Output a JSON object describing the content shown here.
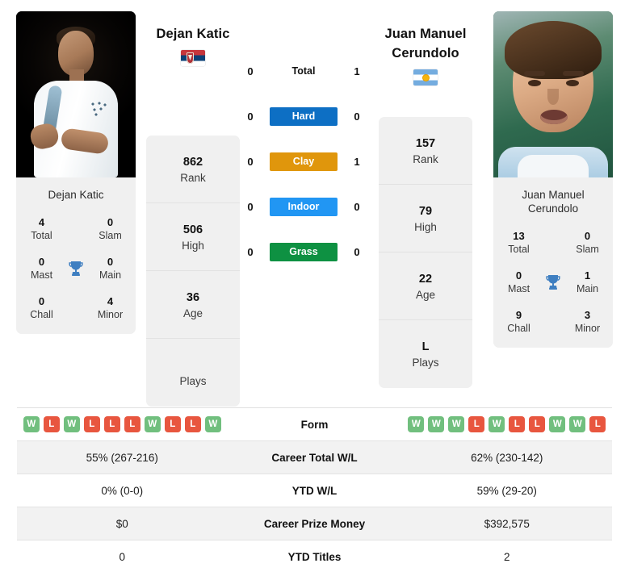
{
  "players": {
    "left": {
      "name": "Dejan Katic",
      "flag": "serbia-flag",
      "card_name": "Dejan Katic",
      "titles": {
        "total_value": "4",
        "total_label": "Total",
        "slam_value": "0",
        "slam_label": "Slam",
        "mast_value": "0",
        "mast_label": "Mast",
        "main_value": "0",
        "main_label": "Main",
        "chall_value": "0",
        "chall_label": "Chall",
        "minor_value": "4",
        "minor_label": "Minor"
      },
      "stats": {
        "rank_value": "862",
        "rank_label": "Rank",
        "high_value": "506",
        "high_label": "High",
        "age_value": "36",
        "age_label": "Age",
        "plays_value": "",
        "plays_label": "Plays"
      },
      "surface_wins": {
        "total": "0",
        "hard": "0",
        "clay": "0",
        "indoor": "0",
        "grass": "0"
      },
      "form": [
        "W",
        "L",
        "W",
        "L",
        "L",
        "L",
        "W",
        "L",
        "L",
        "W"
      ],
      "career_total_wl": "55% (267-216)",
      "ytd_wl": "0% (0-0)",
      "career_prize_money": "$0",
      "ytd_titles": "0"
    },
    "right": {
      "name": "Juan Manuel Cerundolo",
      "flag": "argentina-flag",
      "card_name": "Juan Manuel Cerundolo",
      "titles": {
        "total_value": "13",
        "total_label": "Total",
        "slam_value": "0",
        "slam_label": "Slam",
        "mast_value": "0",
        "mast_label": "Mast",
        "main_value": "1",
        "main_label": "Main",
        "chall_value": "9",
        "chall_label": "Chall",
        "minor_value": "3",
        "minor_label": "Minor"
      },
      "stats": {
        "rank_value": "157",
        "rank_label": "Rank",
        "high_value": "79",
        "high_label": "High",
        "age_value": "22",
        "age_label": "Age",
        "plays_value": "L",
        "plays_label": "Plays"
      },
      "surface_wins": {
        "total": "1",
        "hard": "0",
        "clay": "1",
        "indoor": "0",
        "grass": "0"
      },
      "form": [
        "W",
        "W",
        "W",
        "L",
        "W",
        "L",
        "L",
        "W",
        "W",
        "L"
      ],
      "career_total_wl": "62% (230-142)",
      "ytd_wl": "59% (29-20)",
      "career_prize_money": "$392,575",
      "ytd_titles": "2"
    }
  },
  "surfaces": [
    {
      "key": "total",
      "label": "Total",
      "color": ""
    },
    {
      "key": "hard",
      "label": "Hard",
      "color": "#0d6fc4"
    },
    {
      "key": "clay",
      "label": "Clay",
      "color": "#e0960c"
    },
    {
      "key": "indoor",
      "label": "Indoor",
      "color": "#2196f3"
    },
    {
      "key": "grass",
      "label": "Grass",
      "color": "#0e9142"
    }
  ],
  "comparison_rows": [
    {
      "label": "Form"
    },
    {
      "label": "Career Total W/L"
    },
    {
      "label": "YTD W/L"
    },
    {
      "label": "Career Prize Money"
    },
    {
      "label": "YTD Titles"
    }
  ],
  "colors": {
    "win_badge": "#71bf7e",
    "loss_badge": "#e8563f",
    "trophy": "#3f7fc1",
    "card_bg": "#f0f0f0",
    "row_shade": "#f2f2f2"
  }
}
